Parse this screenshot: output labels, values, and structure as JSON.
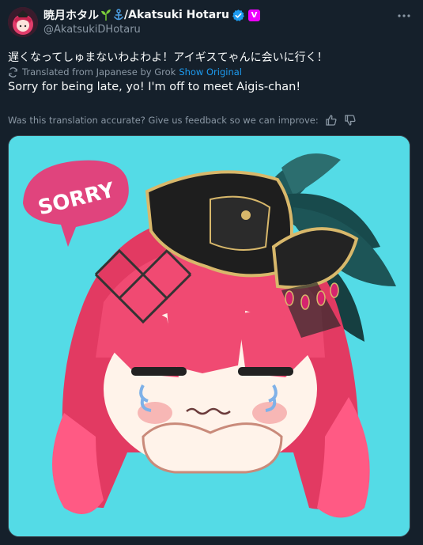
{
  "post": {
    "display_name": "暁月ホタル",
    "name_suffix": "/Akatsuki Hotaru",
    "handle": "@AkatsukiDHotaru",
    "sub_badge": "V",
    "original_text": "遅くなってしゅまないわよわよ！アイギスてゃんに会いに行く！",
    "translated_from": "Translated from Japanese by Grok",
    "show_original": "Show Original",
    "translated_text": "Sorry for being late, yo! I'm off to meet Aigis-chan!",
    "feedback_prompt": "Was this translation accurate? Give us feedback so we can improve:"
  },
  "media": {
    "speech_bubble_text": "SORRY"
  },
  "icons": {
    "more": "more-dots-icon",
    "verified": "verified-badge-icon",
    "translate": "translate-icon",
    "thumbs_up": "thumbs-up-icon",
    "thumbs_down": "thumbs-down-icon"
  },
  "colors": {
    "background": "#15202b",
    "accent": "#1d9bf0",
    "muted": "#8b98a5",
    "media_bg": "#54dbe6"
  }
}
